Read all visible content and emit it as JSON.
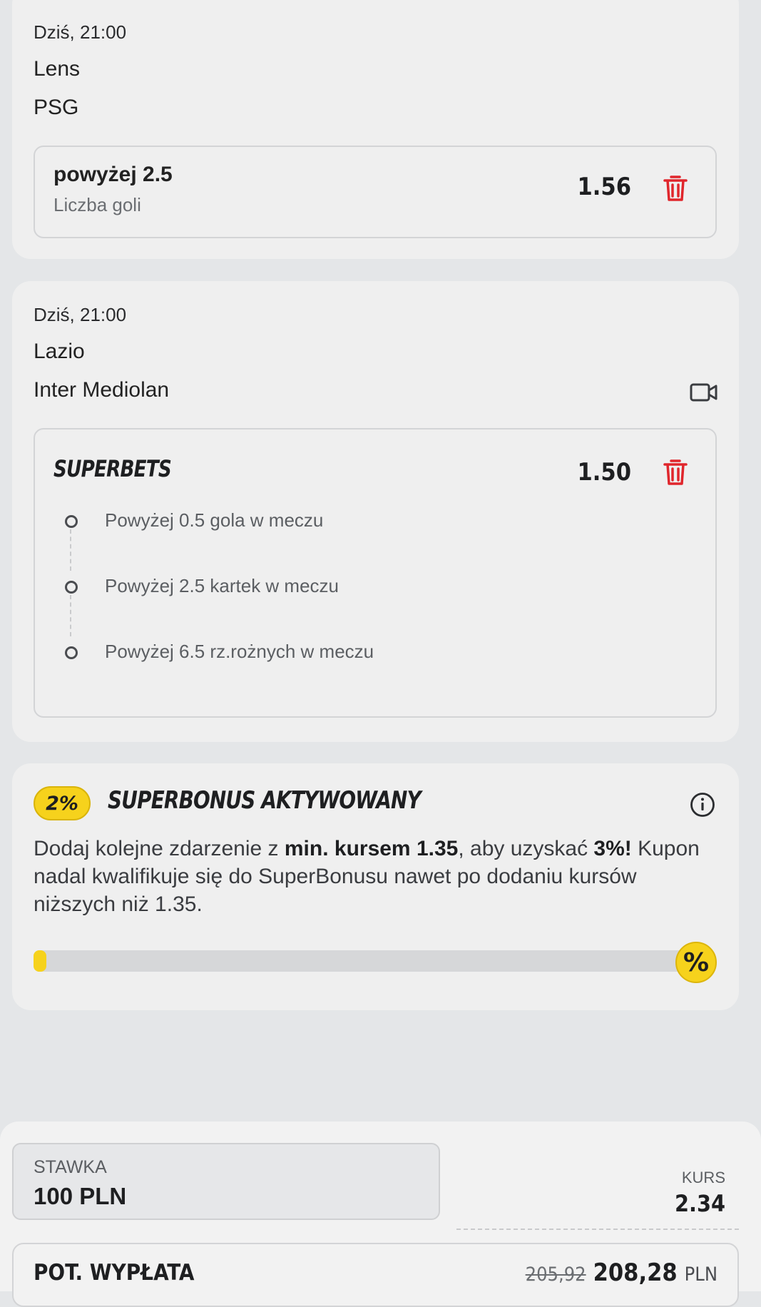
{
  "bets": [
    {
      "datetime": "Dziś, 21:00",
      "home": "Lens",
      "away": "PSG",
      "selection": "powyżej 2.5",
      "market": "Liczba goli",
      "odds": "1.56"
    },
    {
      "datetime": "Dziś, 21:00",
      "home": "Lazio",
      "away": "Inter Mediolan",
      "selection": "SUPERBETS",
      "odds": "1.50",
      "legs": [
        "Powyżej 0.5 gola w meczu",
        "Powyżej 2.5 kartek w meczu",
        "Powyżej 6.5 rz.rożnych w meczu"
      ]
    }
  ],
  "superbonus": {
    "badge": "2%",
    "title": "SUPERBONUS AKTYWOWANY",
    "text_1": "Dodaj kolejne zdarzenie z ",
    "text_bold_1": "min. kursem 1.35",
    "text_2": ", aby uzyskać ",
    "text_bold_2": "3%!",
    "text_3": " Kupon nadal kwalifikuje się do SuperBonusu nawet po dodaniu kursów niższych niż 1.35.",
    "progress": 0.02,
    "end_icon": "%"
  },
  "stake": {
    "label": "STAWKA",
    "value": "100 PLN"
  },
  "odds_total": {
    "label": "KURS",
    "value": "2.34"
  },
  "payout": {
    "label": "POT. WYPŁATA",
    "old_value": "205,92",
    "value": "208,28",
    "currency": "PLN"
  },
  "colors": {
    "accent_red": "#e0262c",
    "badge_yellow": "#f6d21c",
    "card_bg": "#efefef",
    "page_bg": "#e4e6e8"
  }
}
